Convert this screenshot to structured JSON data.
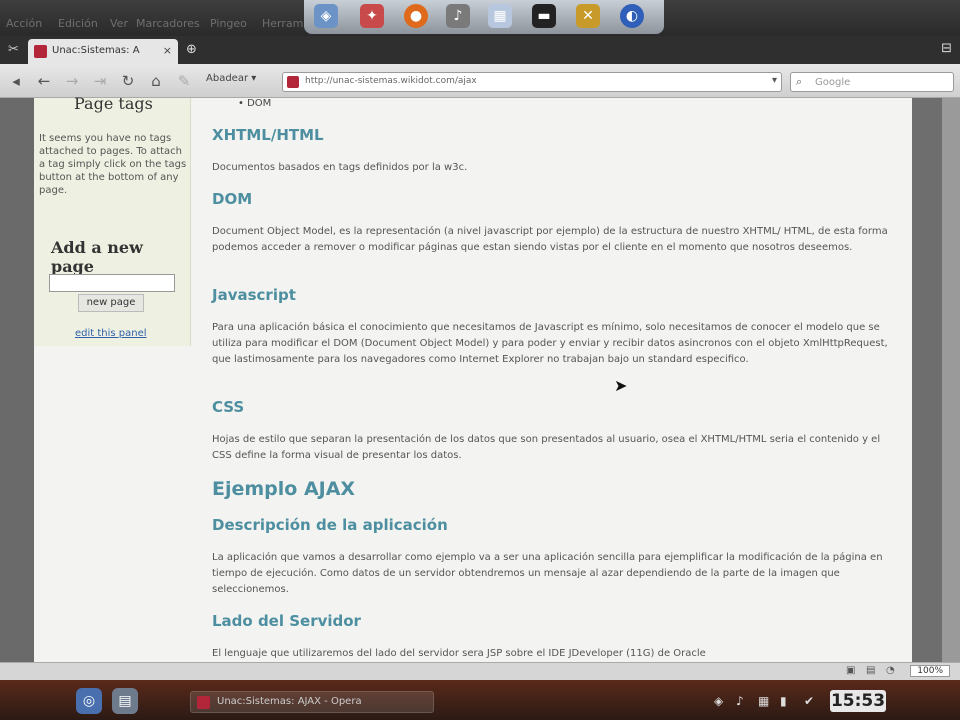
{
  "topbar": {
    "menu": [
      "Acción",
      "Edición",
      "Ver",
      "Marcadores",
      "Pingeo",
      "Herram"
    ],
    "dock_icons": [
      "network-icon",
      "game-icon",
      "firefox-icon",
      "music-icon",
      "window-icon",
      "terminal-icon",
      "tools-icon",
      "globe-icon"
    ]
  },
  "tab": {
    "title": "Unac:Sistemas: A",
    "close": "×",
    "new_tab": "⊕",
    "menu": "⊟"
  },
  "toolbar": {
    "zoom_select": "Abadear ▾",
    "url": "http://unac-sistemas.wikidot.com/ajax",
    "search_placeholder": "Google"
  },
  "sidebar": {
    "page_tags_heading": "Page tags",
    "tags_text": "It seems you have no tags attached to pages. To attach a tag simply click on the tags button at the bottom of any page.",
    "add_page_heading": "Add a new page",
    "new_page_button": "new page",
    "edit_link": "edit this panel"
  },
  "content": {
    "bullet": "DOM",
    "sections": [
      {
        "heading": "XHTML/HTML",
        "text": "Documentos basados en tags definidos por la w3c."
      },
      {
        "heading": "DOM",
        "text": "Document Object Model, es la representación (a nivel javascript por ejemplo) de la estructura de nuestro XHTML/ HTML, de esta forma podemos acceder a remover o modificar páginas que estan siendo vistas por el cliente en el momento que nosotros deseemos."
      },
      {
        "heading": "Javascript",
        "text": "Para una aplicación básica el conocimiento que necesitamos de Javascript es mínimo, solo necesitamos de conocer el modelo que se utiliza para modificar el DOM (Document Object Model) y para poder y enviar y recibir datos asincronos con el objeto XmlHttpRequest, que lastimosamente para los navegadores como Internet Explorer no trabajan bajo un standard especifico."
      },
      {
        "heading": "CSS",
        "text": "Hojas de estilo que separan la presentación de los datos que son presentados al usuario, osea el XHTML/HTML seria el contenido y el CSS define la forma visual de presentar los datos."
      }
    ],
    "main_heading": "Ejemplo AJAX",
    "sub_sections": [
      {
        "heading": "Descripción de la aplicación",
        "text": "La aplicación que vamos a desarrollar como ejemplo va a ser una aplicación sencilla para ejemplificar la modificación de la página en tiempo de ejecución. Como datos de un servidor obtendremos un mensaje al azar dependiendo de la parte de la imagen que seleccionemos."
      },
      {
        "heading": "Lado del Servidor",
        "text": "El lenguaje que utilizaremos del lado del servidor sera JSP sobre el IDE JDeveloper (11G) de Oracle"
      }
    ]
  },
  "statusbar": {
    "zoom": "100%"
  },
  "taskbar": {
    "task_title": "Unac:Sistemas: AJAX - Opera",
    "clock": "15:53"
  }
}
